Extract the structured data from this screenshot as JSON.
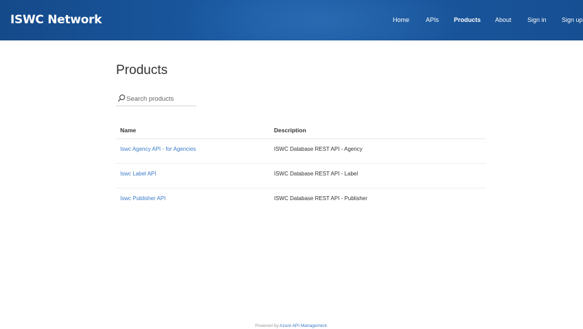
{
  "header": {
    "logo": "ISWC Network",
    "nav": [
      {
        "label": "Home",
        "active": false
      },
      {
        "label": "APIs",
        "active": false
      },
      {
        "label": "Products",
        "active": true
      },
      {
        "label": "About",
        "active": false
      },
      {
        "label": "Sign in",
        "active": false
      },
      {
        "label": "Sign up",
        "active": false
      }
    ]
  },
  "page": {
    "title": "Products",
    "search": {
      "placeholder": "Search products",
      "value": "",
      "icon": "search-icon"
    }
  },
  "table": {
    "columns": [
      "Name",
      "Description"
    ],
    "rows": [
      {
        "name": "Iswc Agency API - for Agencies",
        "description": "ISWC Database REST API - Agency"
      },
      {
        "name": "Iswc Label API",
        "description": "ISWC Database REST API - Label"
      },
      {
        "name": "Iswc Publisher API",
        "description": "ISWC Database REST API - Publisher"
      }
    ]
  },
  "footer": {
    "prefix": "Powered by ",
    "link": "Azure API Management",
    "suffix": "."
  },
  "colors": {
    "header": "#1a5aa3",
    "link": "#3a7bc8"
  }
}
